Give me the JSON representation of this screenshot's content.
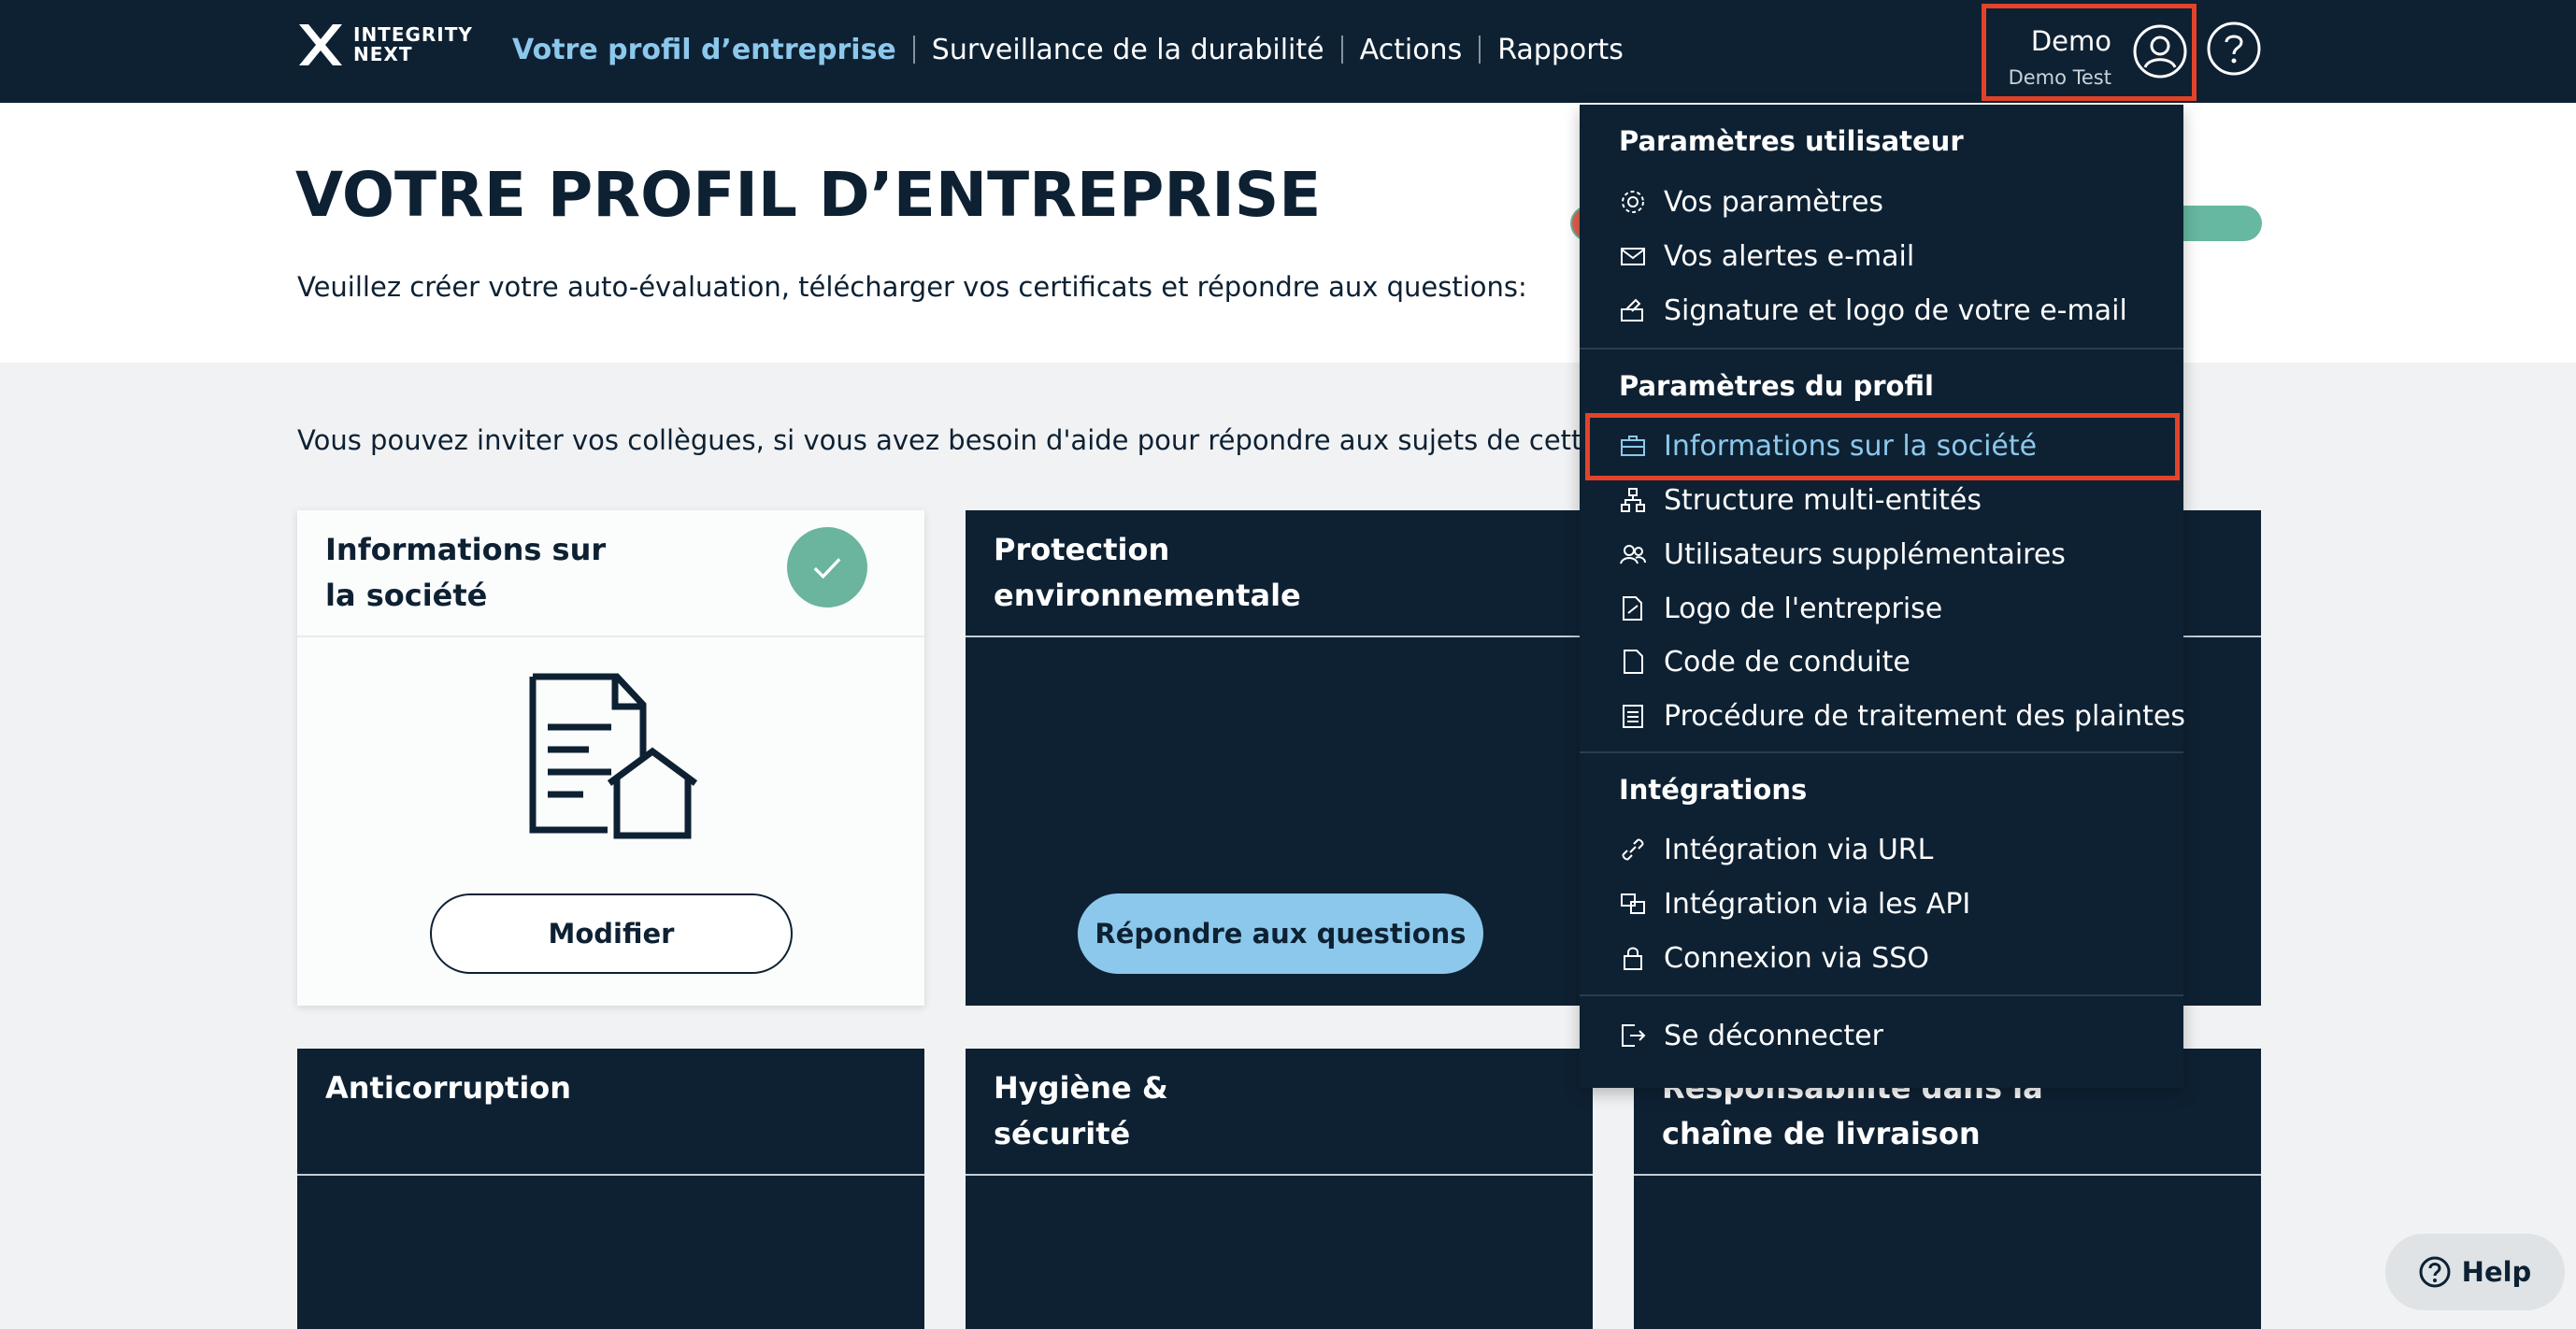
{
  "brand": {
    "logo_text_line1": "INTEGRITY",
    "logo_text_line2": "NEXT"
  },
  "nav": {
    "items": [
      {
        "label": "Votre profil d’entreprise",
        "active": true
      },
      {
        "label": "Surveillance de la durabilité",
        "active": false
      },
      {
        "label": "Actions",
        "active": false
      },
      {
        "label": "Rapports",
        "active": false
      }
    ]
  },
  "user": {
    "name": "Demo",
    "subtitle": "Demo Test"
  },
  "header": {
    "title": "VOTRE PROFIL D’ENTREPRISE",
    "subtitle": "Veuillez créer votre auto-évaluation, télécharger vos certificats et répondre aux questions:"
  },
  "invite_text": "Vous pouvez inviter vos collègues, si vous avez besoin d'aide pour répondre aux sujets de cette éva",
  "cards": [
    {
      "title": "Informations sur la société",
      "button": "Modifier"
    },
    {
      "title": "Protection environnementale",
      "button": "Répondre aux questions"
    },
    {
      "title": "Anticorruption"
    },
    {
      "title": "Hygiène & sécurité"
    },
    {
      "title": "Responsabilité dans la chaîne de livraison"
    }
  ],
  "dropdown": {
    "section_user": "Paramètres utilisateur",
    "user_items": [
      "Vos paramètres",
      "Vos alertes e-mail",
      "Signature et logo de votre e-mail"
    ],
    "section_profile": "Paramètres du profil",
    "profile_items": [
      "Informations sur la société",
      "Structure multi-entités",
      "Utilisateurs supplémentaires",
      "Logo de l'entreprise",
      "Code de conduite",
      "Procédure de traitement des plaintes"
    ],
    "section_integrations": "Intégrations",
    "integration_items": [
      "Intégration via URL",
      "Intégration via les API",
      "Connexion via SSO"
    ],
    "logout": "Se déconnecter"
  },
  "help_button": "Help",
  "colors": {
    "navy": "#0e2133",
    "accent_blue": "#8cc8ec",
    "highlight_red": "#e2432a",
    "success_green": "#6bb49e"
  }
}
